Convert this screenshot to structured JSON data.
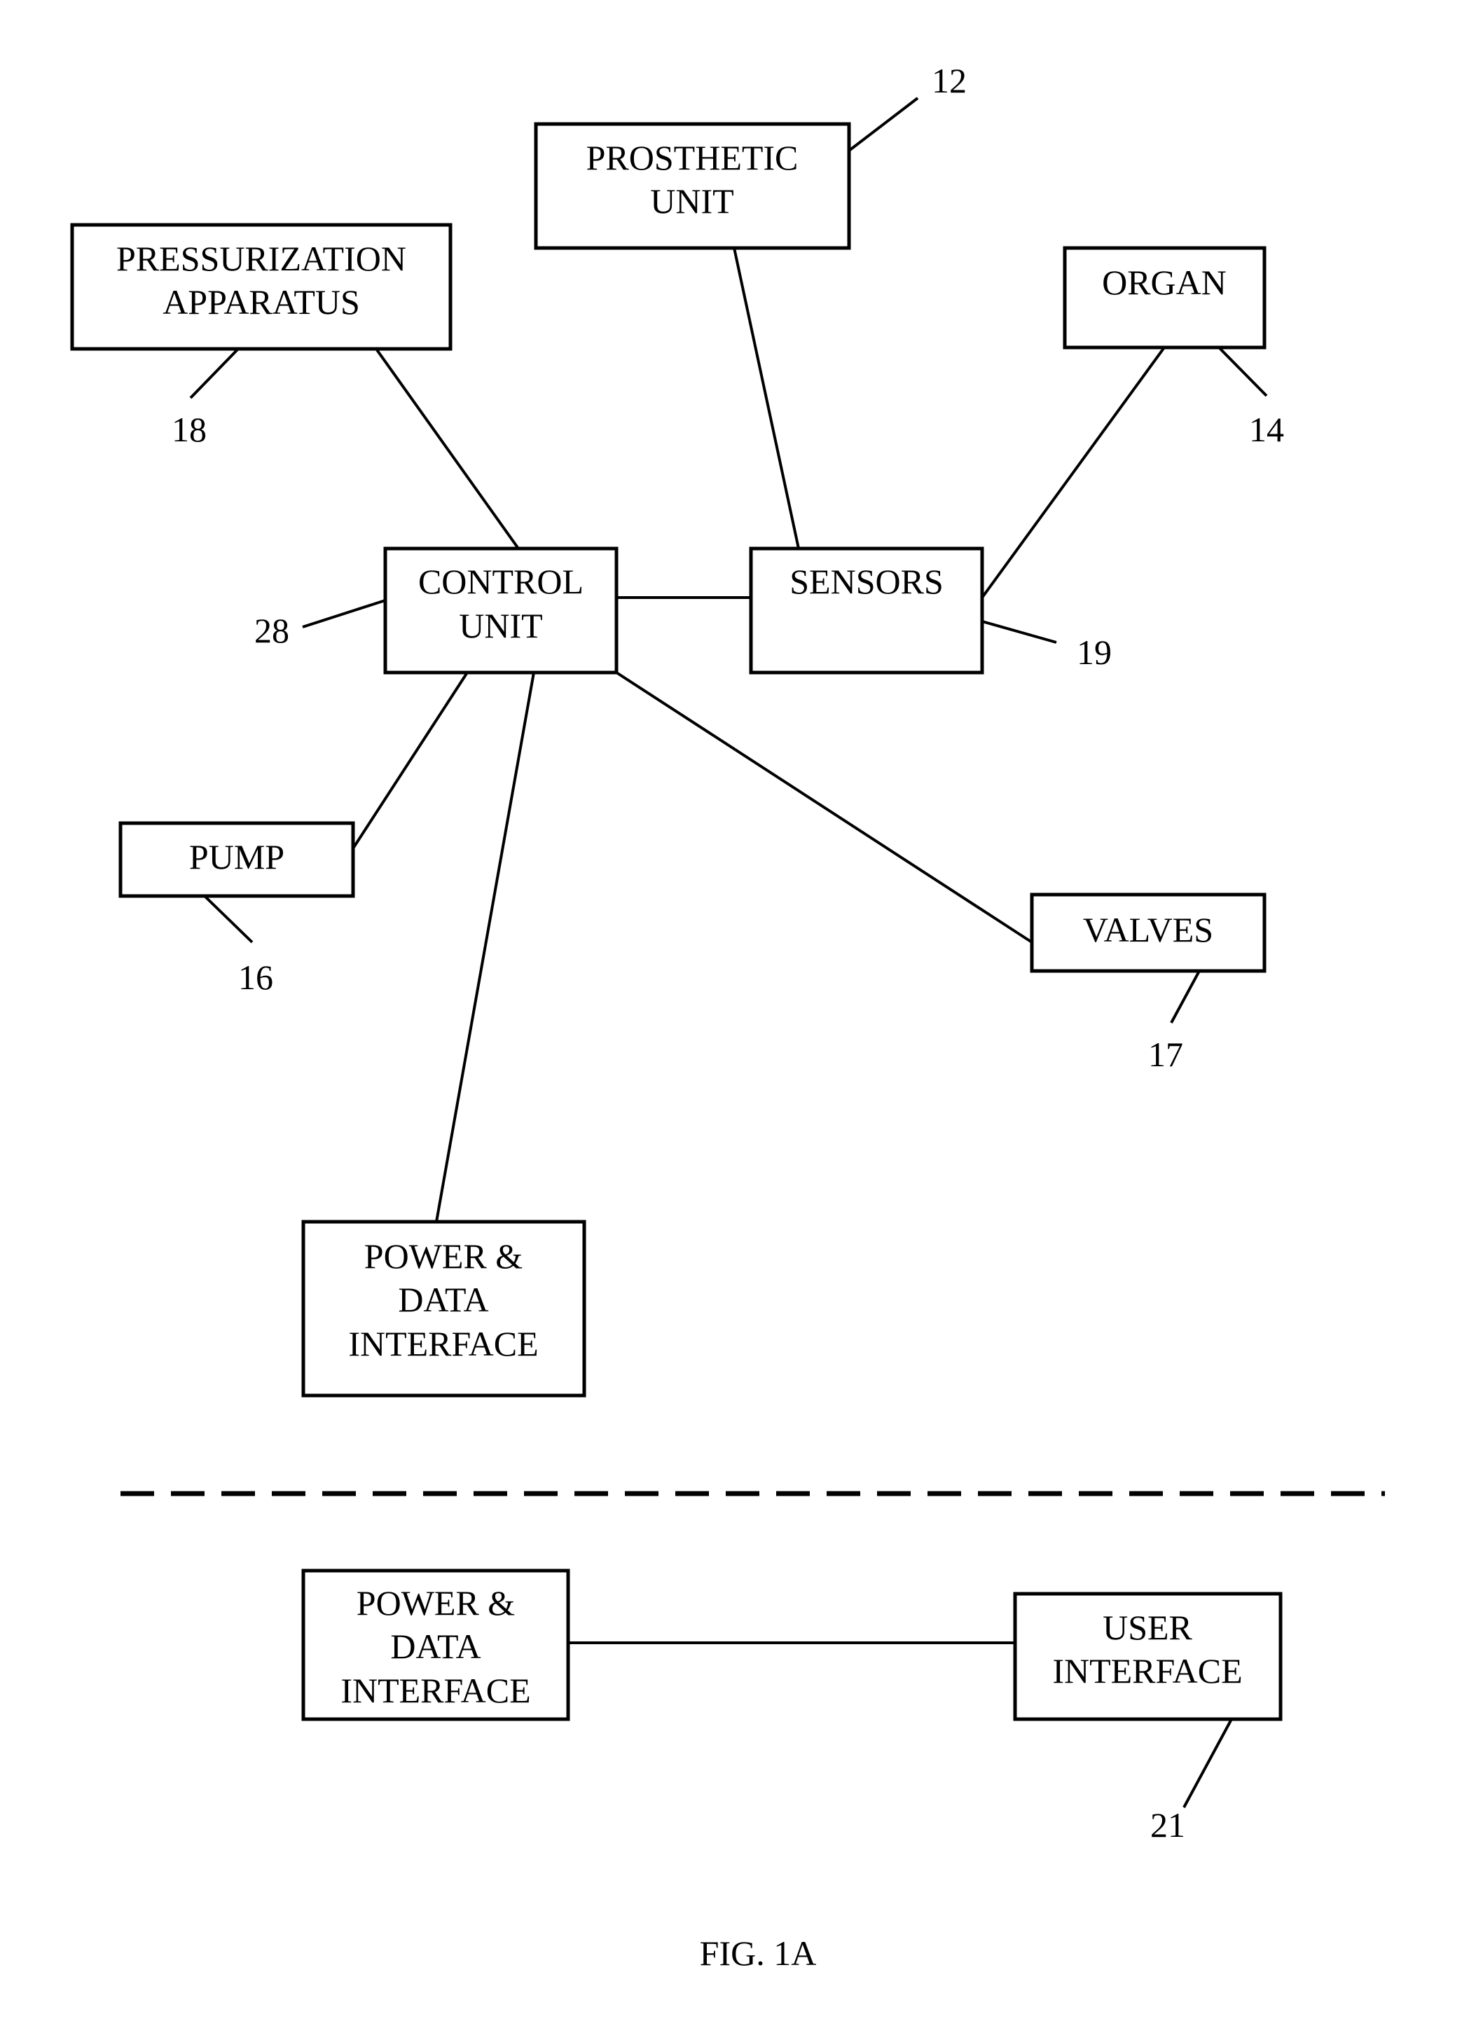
{
  "figure": {
    "caption": "FIG. 1A",
    "colors": {
      "ink": "#000000",
      "paper": "#ffffff"
    }
  },
  "blocks": {
    "pressurization": {
      "lines": [
        "PRESSURIZATION",
        "APPARATUS"
      ],
      "ref": "18"
    },
    "prosthetic": {
      "lines": [
        "PROSTHETIC",
        "UNIT"
      ],
      "ref": "12"
    },
    "organ": {
      "lines": [
        "ORGAN"
      ],
      "ref": "14"
    },
    "control": {
      "lines": [
        "CONTROL",
        "UNIT"
      ],
      "ref": "28"
    },
    "sensors": {
      "lines": [
        "SENSORS"
      ],
      "ref": "19"
    },
    "pump": {
      "lines": [
        "PUMP"
      ],
      "ref": "16"
    },
    "valves": {
      "lines": [
        "VALVES"
      ],
      "ref": "17"
    },
    "power_data_top": {
      "lines": [
        "POWER &",
        "DATA",
        "INTERFACE"
      ]
    },
    "power_data_bottom": {
      "lines": [
        "POWER &",
        "DATA",
        "INTERFACE"
      ]
    },
    "user_interface": {
      "lines": [
        "USER",
        "INTERFACE"
      ],
      "ref": "21"
    }
  },
  "connections": [
    {
      "from": "control",
      "to": "pressurization"
    },
    {
      "from": "control",
      "to": "sensors"
    },
    {
      "from": "sensors",
      "to": "prosthetic"
    },
    {
      "from": "sensors",
      "to": "organ"
    },
    {
      "from": "control",
      "to": "pump"
    },
    {
      "from": "control",
      "to": "valves"
    },
    {
      "from": "control",
      "to": "power_data_top"
    },
    {
      "from": "power_data_bottom",
      "to": "user_interface"
    }
  ]
}
